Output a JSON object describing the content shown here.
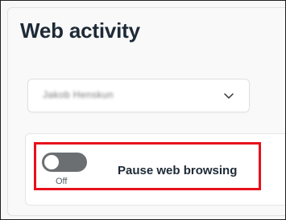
{
  "page": {
    "title": "Web activity"
  },
  "account_dropdown": {
    "selected_value": "Jakob Henskun",
    "icon": "chevron-down-icon"
  },
  "pause_setting": {
    "toggle_state": "Off",
    "label": "Pause web browsing",
    "toggle_on": false
  },
  "colors": {
    "highlight": "#e8101b",
    "toggle_off": "#6b6f72",
    "title_text": "#1e2a36"
  }
}
